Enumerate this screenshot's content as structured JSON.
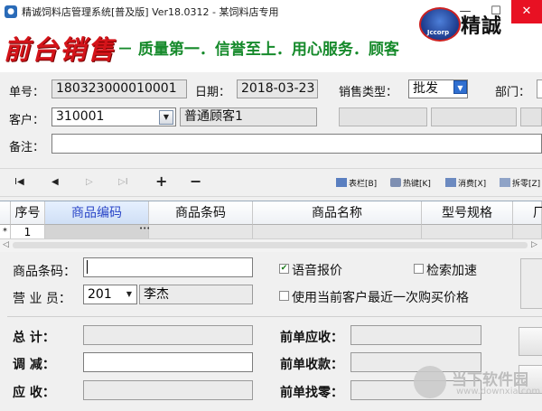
{
  "window": {
    "title": "精诚饲料店管理系统[普及版] Ver18.0312  - 某饲料店专用",
    "minimize_glyph": "—",
    "maximize_glyph": "☐",
    "close_glyph": "✕"
  },
  "banner": {
    "brand": "前台销售",
    "slogan": "－ 质量第一．信誉至上．用心服务．顾客",
    "logo_badge": "Jccorp",
    "logo_text": "精誠"
  },
  "header": {
    "doc_no_label": "单号：",
    "doc_no": "180323000010001",
    "date_label": "日期：",
    "date": "2018-03-23",
    "sale_type_label": "销售类型：",
    "sale_type": "批发",
    "dept_label": "部门：",
    "customer_label": "客户：",
    "customer_code": "310001",
    "customer_name": "普通顾客1",
    "remark_label": "备注："
  },
  "toolbar": {
    "first": "I◀",
    "prev": "◀",
    "next": "▷",
    "last": "▷I",
    "add": "+",
    "remove": "−",
    "columns": "表栏[B]",
    "hotkeys": "热键[K]",
    "void": "消费[X]",
    "unit_split": "拆零[Z]"
  },
  "grid": {
    "columns": [
      "序号",
      "商品编码",
      "商品条码",
      "商品名称",
      "型号规格",
      "厂"
    ],
    "row_marker": "*",
    "rows": [
      {
        "seq": "1",
        "code": "",
        "barcode": "",
        "name": "",
        "spec": ""
      }
    ]
  },
  "entry": {
    "barcode_label": "商品条码：",
    "barcode_value": "",
    "staff_label": "营 业 员：",
    "staff_code": "201",
    "staff_name": "李杰",
    "voice_label": "语音报价",
    "voice_checked": true,
    "search_speed_label": "检索加速",
    "search_speed_checked": false,
    "last_price_label": "使用当前客户最近一次购买价格",
    "last_price_checked": false
  },
  "summary": {
    "total_label": "总    计：",
    "adjust_label": "调    减：",
    "receivable_label": "应    收：",
    "prev_receivable_label": "前单应收：",
    "prev_received_label": "前单收款：",
    "prev_change_label": "前单找零："
  },
  "watermark": {
    "text": "当下软件园",
    "url": "www.downxia.com"
  },
  "colors": {
    "brand_red": "#d4141a",
    "slogan_green": "#168a2b",
    "selected_header_blue": "#2b47c8"
  }
}
